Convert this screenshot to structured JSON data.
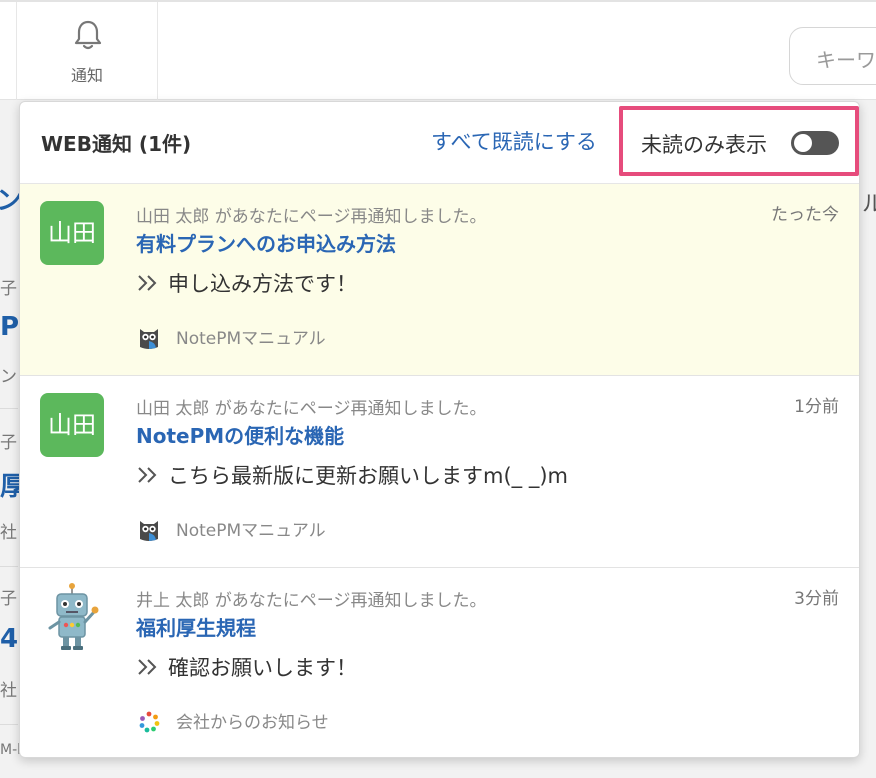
{
  "topbar": {
    "notification_label": "通知",
    "search_placeholder": "キーワ"
  },
  "background_fragments": [
    "ン",
    "子",
    "P",
    "ン",
    "子",
    "厚",
    "社",
    "子",
    "4",
    "社",
    "M-b",
    "ル"
  ],
  "panel": {
    "title": "WEB通知 (1件)",
    "mark_all_read": "すべて既読にする",
    "unread_only_label": "未読のみ表示",
    "unread_only_enabled": false,
    "highlight_color": "#e64c7c",
    "items": [
      {
        "avatar_text": "山田",
        "avatar_color": "#5cb85c",
        "meta": "山田 太郎 があなたにページ再通知しました。",
        "time": "たった今",
        "title": "有料プランへのお申込み方法",
        "message": "申し込み方法です！",
        "source": "NotePMマニュアル",
        "source_icon": "owl-icon",
        "unread": true
      },
      {
        "avatar_text": "山田",
        "avatar_color": "#5cb85c",
        "meta": "山田 太郎 があなたにページ再通知しました。",
        "time": "1分前",
        "title": "NotePMの便利な機能",
        "message": "こちら最新版に更新お願いしますm(_ _)m",
        "source": "NotePMマニュアル",
        "source_icon": "owl-icon",
        "unread": false
      },
      {
        "avatar_icon": "robot-avatar",
        "meta": "井上 太郎 があなたにページ再通知しました。",
        "time": "3分前",
        "title": "福利厚生規程",
        "message": "確認お願いします！",
        "source": "会社からのお知らせ",
        "source_icon": "dots-icon",
        "unread": false
      }
    ]
  }
}
